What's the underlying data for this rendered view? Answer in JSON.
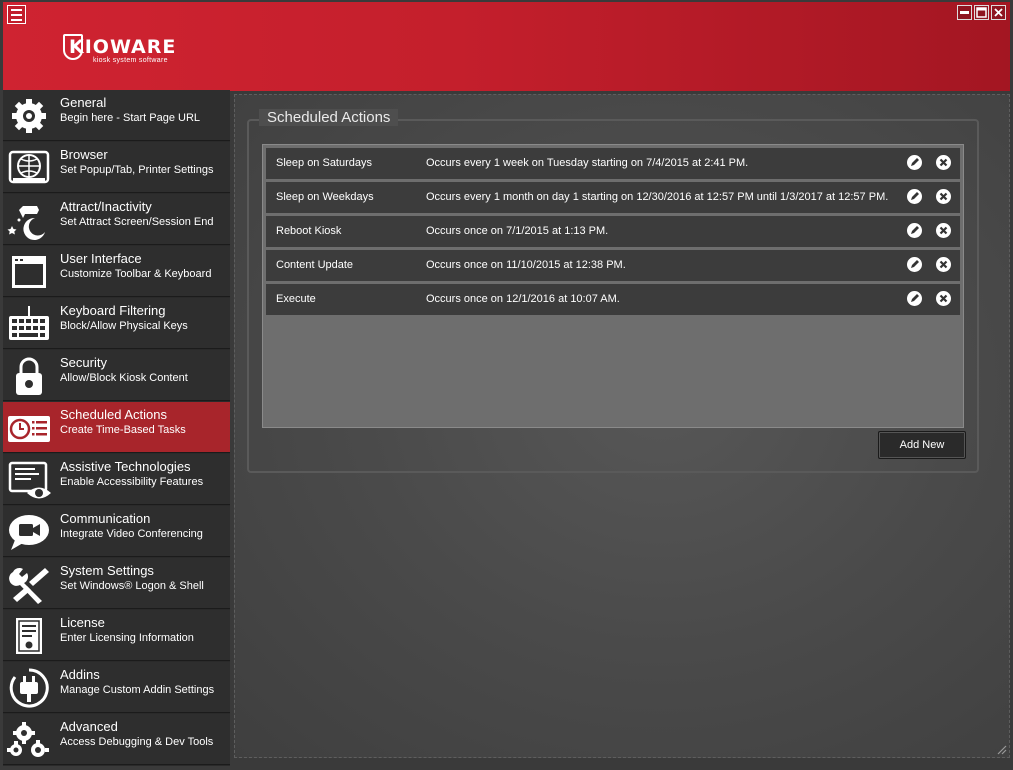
{
  "app": {
    "logo_text": "KIOWARE",
    "logo_tagline": "kiosk system software"
  },
  "sidebar": {
    "items": [
      {
        "title": "General",
        "subtitle": "Begin here - Start Page URL",
        "icon": "gear-icon"
      },
      {
        "title": "Browser",
        "subtitle": "Set Popup/Tab, Printer Settings",
        "icon": "globe-browser-icon"
      },
      {
        "title": "Attract/Inactivity",
        "subtitle": "Set Attract Screen/Session End",
        "icon": "moon-cow-icon"
      },
      {
        "title": "User Interface",
        "subtitle": "Customize Toolbar & Keyboard",
        "icon": "window-icon"
      },
      {
        "title": "Keyboard Filtering",
        "subtitle": "Block/Allow Physical Keys",
        "icon": "keyboard-icon"
      },
      {
        "title": "Security",
        "subtitle": "Allow/Block Kiosk Content",
        "icon": "padlock-icon"
      },
      {
        "title": "Scheduled Actions",
        "subtitle": "Create Time-Based Tasks",
        "icon": "clock-list-icon"
      },
      {
        "title": "Assistive Technologies",
        "subtitle": "Enable Accessibility Features",
        "icon": "screen-eye-icon"
      },
      {
        "title": "Communication",
        "subtitle": "Integrate Video Conferencing",
        "icon": "video-chat-icon"
      },
      {
        "title": "System Settings",
        "subtitle": "Set Windows® Logon & Shell",
        "icon": "tools-icon"
      },
      {
        "title": "License",
        "subtitle": "Enter Licensing Information",
        "icon": "certificate-icon"
      },
      {
        "title": "Addins",
        "subtitle": "Manage Custom Addin Settings",
        "icon": "plug-icon"
      },
      {
        "title": "Advanced",
        "subtitle": "Access Debugging & Dev Tools",
        "icon": "gears-icon"
      }
    ],
    "active_index": 6
  },
  "main": {
    "section_title": "Scheduled Actions",
    "rows": [
      {
        "name": "Sleep on Saturdays",
        "description": "Occurs every 1 week on Tuesday starting on 7/4/2015 at 2:41 PM."
      },
      {
        "name": "Sleep on Weekdays",
        "description": "Occurs every 1 month on day 1 starting on 12/30/2016 at 12:57 PM until 1/3/2017 at 12:57 PM."
      },
      {
        "name": "Reboot Kiosk",
        "description": "Occurs once on 7/1/2015 at 1:13 PM."
      },
      {
        "name": "Content Update",
        "description": "Occurs once on 11/10/2015 at 12:38 PM."
      },
      {
        "name": "Execute",
        "description": "Occurs once on 12/1/2016 at 10:07 AM."
      }
    ],
    "add_button_label": "Add New"
  },
  "colors": {
    "header_red": "#cf2331",
    "active_item": "#a8252b",
    "row_bg": "#3c3c3c",
    "list_bg": "#6e6e6e"
  }
}
